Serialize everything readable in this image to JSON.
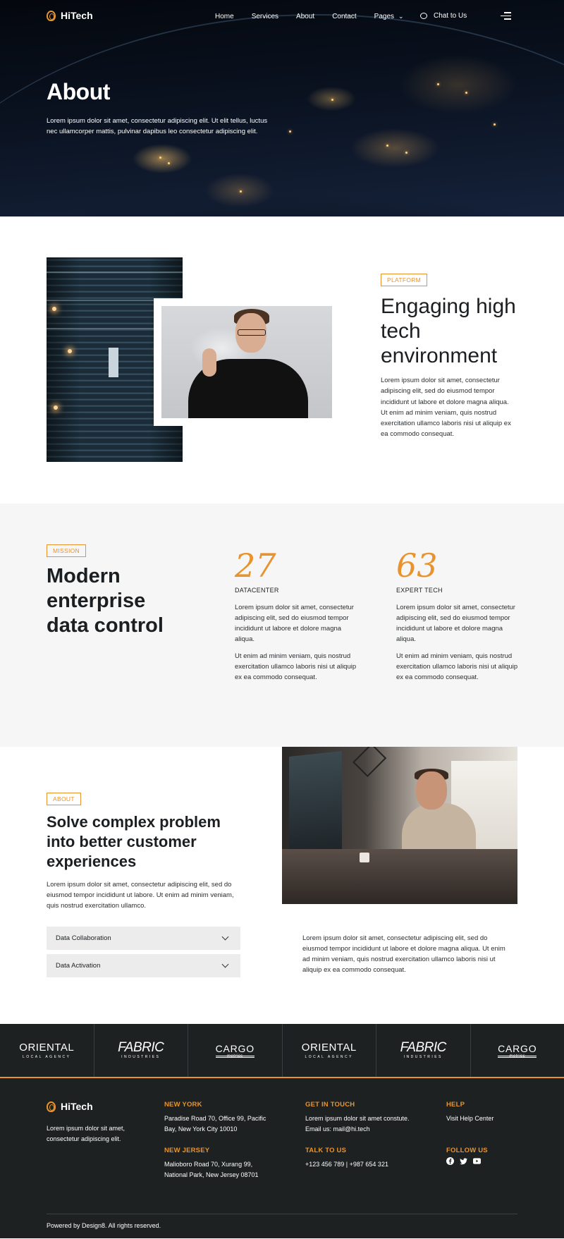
{
  "brand": {
    "name": "HiTech",
    "accent": "#e8932e"
  },
  "nav": {
    "links": [
      "Home",
      "Services",
      "About",
      "Contact",
      "Pages"
    ],
    "chat_label": "Chat to Us"
  },
  "hero": {
    "title": "About",
    "text": "Lorem ipsum dolor sit amet, consectetur adipiscing elit. Ut elit tellus, luctus nec ullamcorper mattis, pulvinar dapibus leo consectetur adipiscing elit."
  },
  "platform": {
    "tag": "PLATFORM",
    "heading": "Engaging high tech environment",
    "text": "Lorem ipsum dolor sit amet, consectetur adipiscing elit, sed do eiusmod tempor incididunt ut labore et dolore magna aliqua. Ut enim ad minim veniam, quis nostrud exercitation ullamco laboris nisi ut aliquip ex ea commodo consequat."
  },
  "mission": {
    "tag": "MISSION",
    "heading": "Modern enterprise data control",
    "stats": [
      {
        "number": "27",
        "label": "DATACENTER",
        "p1": "Lorem ipsum dolor sit amet, consectetur adipiscing elit, sed do eiusmod tempor incididunt ut labore et dolore magna aliqua.",
        "p2": "Ut enim ad minim veniam, quis nostrud exercitation ullamco laboris nisi ut aliquip ex ea commodo consequat."
      },
      {
        "number": "63",
        "label": "EXPERT TECH",
        "p1": "Lorem ipsum dolor sit amet, consectetur adipiscing elit, sed do eiusmod tempor incididunt ut labore et dolore magna aliqua.",
        "p2": "Ut enim ad minim veniam, quis nostrud exercitation ullamco laboris nisi ut aliquip ex ea commodo consequat."
      }
    ]
  },
  "about": {
    "tag": "ABOUT",
    "heading": "Solve complex problem into better customer experiences",
    "text": "Lorem ipsum dolor sit amet, consectetur adipiscing elit, sed do eiusmod tempor incididunt ut labore. Ut enim ad minim veniam, quis nostrud exercitation ullamco.",
    "accordion": [
      "Data Collaboration",
      "Data Activation"
    ],
    "text2": "Lorem ipsum dolor sit amet, consectetur adipiscing elit, sed do eiusmod tempor incididunt ut labore et dolore magna aliqua. Ut enim ad minim veniam, quis nostrud exercitation ullamco laboris nisi ut aliquip ex ea commodo consequat."
  },
  "logos": [
    {
      "name": "ORIENTAL",
      "sub": "LOCAL AGENCY",
      "style": "oriental"
    },
    {
      "name": "FABRIC",
      "sub": "INDUSTRIES",
      "style": "fabric"
    },
    {
      "name": "CARGO",
      "sub": "metrics",
      "style": "cargo"
    },
    {
      "name": "ORIENTAL",
      "sub": "LOCAL AGENCY",
      "style": "oriental"
    },
    {
      "name": "FABRIC",
      "sub": "INDUSTRIES",
      "style": "fabric"
    },
    {
      "name": "CARGO",
      "sub": "metrics",
      "style": "cargo"
    }
  ],
  "footer": {
    "tagline": "Lorem ipsum dolor sit amet, consectetur adipiscing elit.",
    "new_york": {
      "heading": "NEW YORK",
      "text": "Paradise Road 70, Office 99, Pacific Bay,  New York City 10010"
    },
    "new_jersey": {
      "heading": "NEW JERSEY",
      "text": "Malioboro Road 70, Xurang 99, National Park, New Jersey 08701"
    },
    "get_in_touch": {
      "heading": "GET IN TOUCH",
      "text": "Lorem ipsum dolor sit amet constute. Email us: mail@hi.tech"
    },
    "talk_to_us": {
      "heading": "TALK TO US",
      "text": "+123 456 789 | +987 654 321"
    },
    "help": {
      "heading": "HELP",
      "text": "Visit Help Center"
    },
    "follow_us": {
      "heading": "FOLLOW US",
      "icons": [
        "facebook-icon",
        "twitter-icon",
        "youtube-icon"
      ]
    },
    "copyright": "Powered by Design8. All rights reserved."
  }
}
